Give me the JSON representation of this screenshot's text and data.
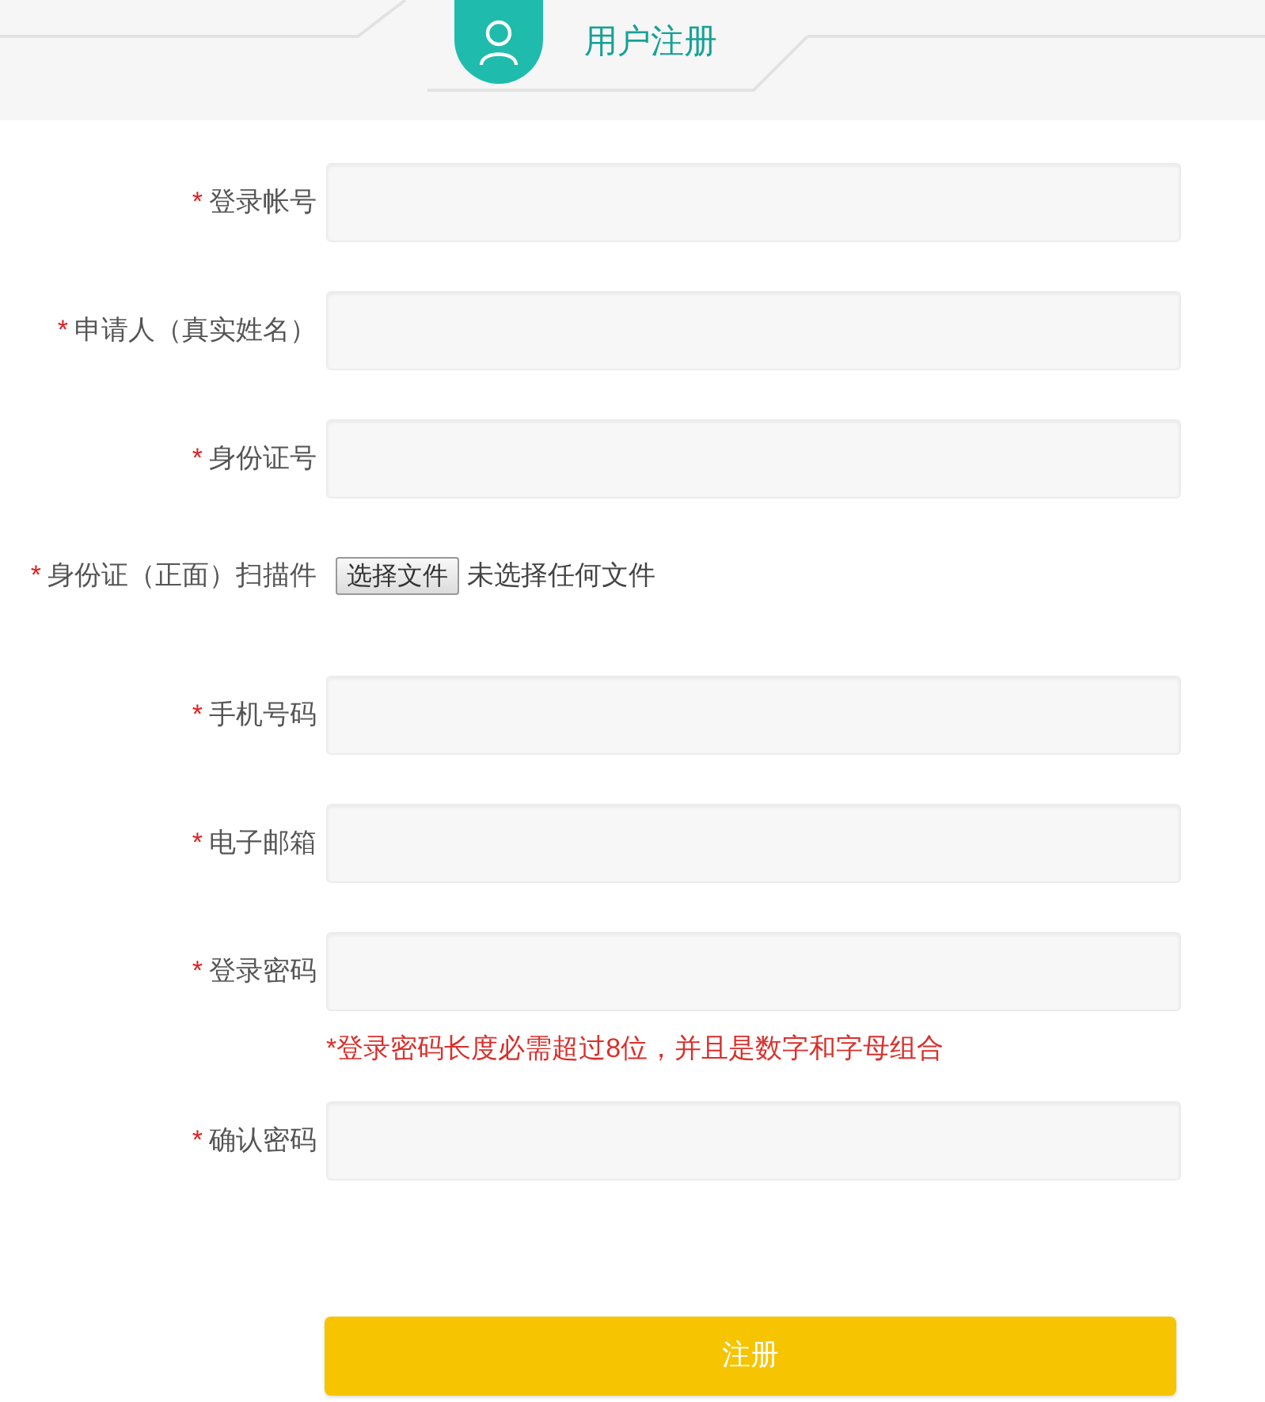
{
  "header": {
    "title": "用户注册"
  },
  "fields": [
    {
      "kind": "text",
      "label": "登录帐号",
      "required": true
    },
    {
      "kind": "text",
      "label": "申请人（真实姓名）",
      "required": true
    },
    {
      "kind": "text",
      "label": "身份证号",
      "required": true
    },
    {
      "kind": "file",
      "label": "身份证（正面）扫描件",
      "required": true,
      "button": "选择文件",
      "status": "未选择任何文件"
    },
    {
      "kind": "text",
      "label": "手机号码",
      "required": true
    },
    {
      "kind": "text",
      "label": "电子邮箱",
      "required": true
    },
    {
      "kind": "text",
      "label": "登录密码",
      "required": true,
      "hint": "*登录密码长度必需超过8位，并且是数字和字母组合"
    },
    {
      "kind": "text",
      "label": "确认密码",
      "required": true
    }
  ],
  "required_mark": "*",
  "submit": "注册"
}
